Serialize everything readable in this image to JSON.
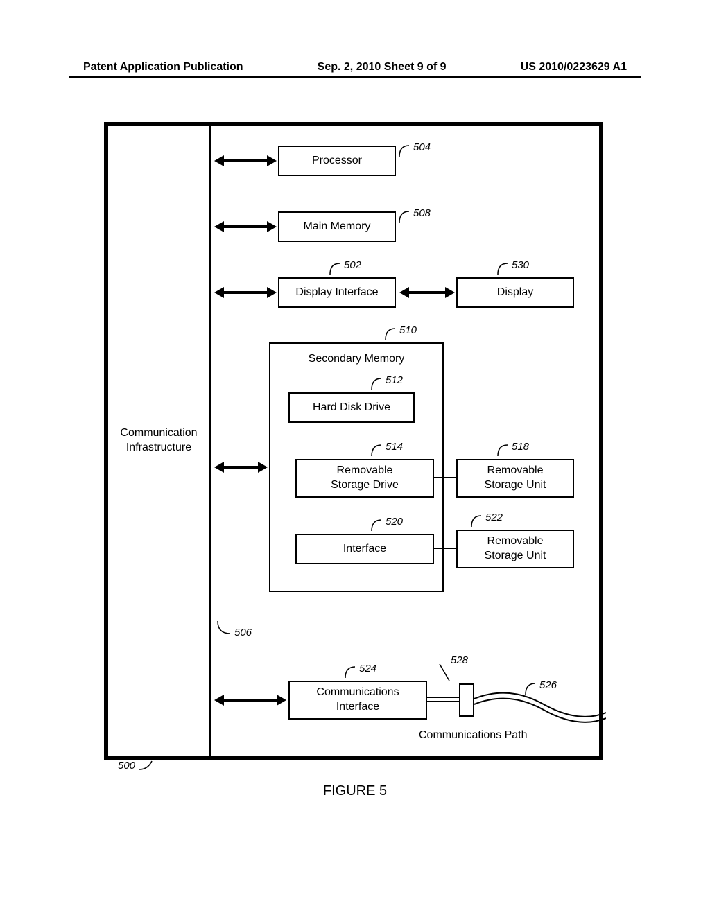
{
  "header": {
    "left": "Patent Application Publication",
    "center": "Sep. 2, 2010  Sheet 9 of 9",
    "right": "US 2010/0223629 A1"
  },
  "blocks": {
    "comm_infra": "Communication\nInfrastructure",
    "processor": "Processor",
    "main_memory": "Main Memory",
    "display_interface": "Display Interface",
    "display": "Display",
    "secondary_memory": "Secondary Memory",
    "hard_disk": "Hard Disk Drive",
    "removable_drive": "Removable\nStorage Drive",
    "removable_unit_1": "Removable\nStorage Unit",
    "interface": "Interface",
    "removable_unit_2": "Removable\nStorage Unit",
    "comm_interface": "Communications\nInterface",
    "comm_path": "Communications Path"
  },
  "refs": {
    "r500": "500",
    "r502": "502",
    "r504": "504",
    "r506": "506",
    "r508": "508",
    "r510": "510",
    "r512": "512",
    "r514": "514",
    "r518": "518",
    "r520": "520",
    "r522": "522",
    "r524": "524",
    "r526": "526",
    "r528": "528",
    "r530": "530"
  },
  "caption": "FIGURE 5"
}
